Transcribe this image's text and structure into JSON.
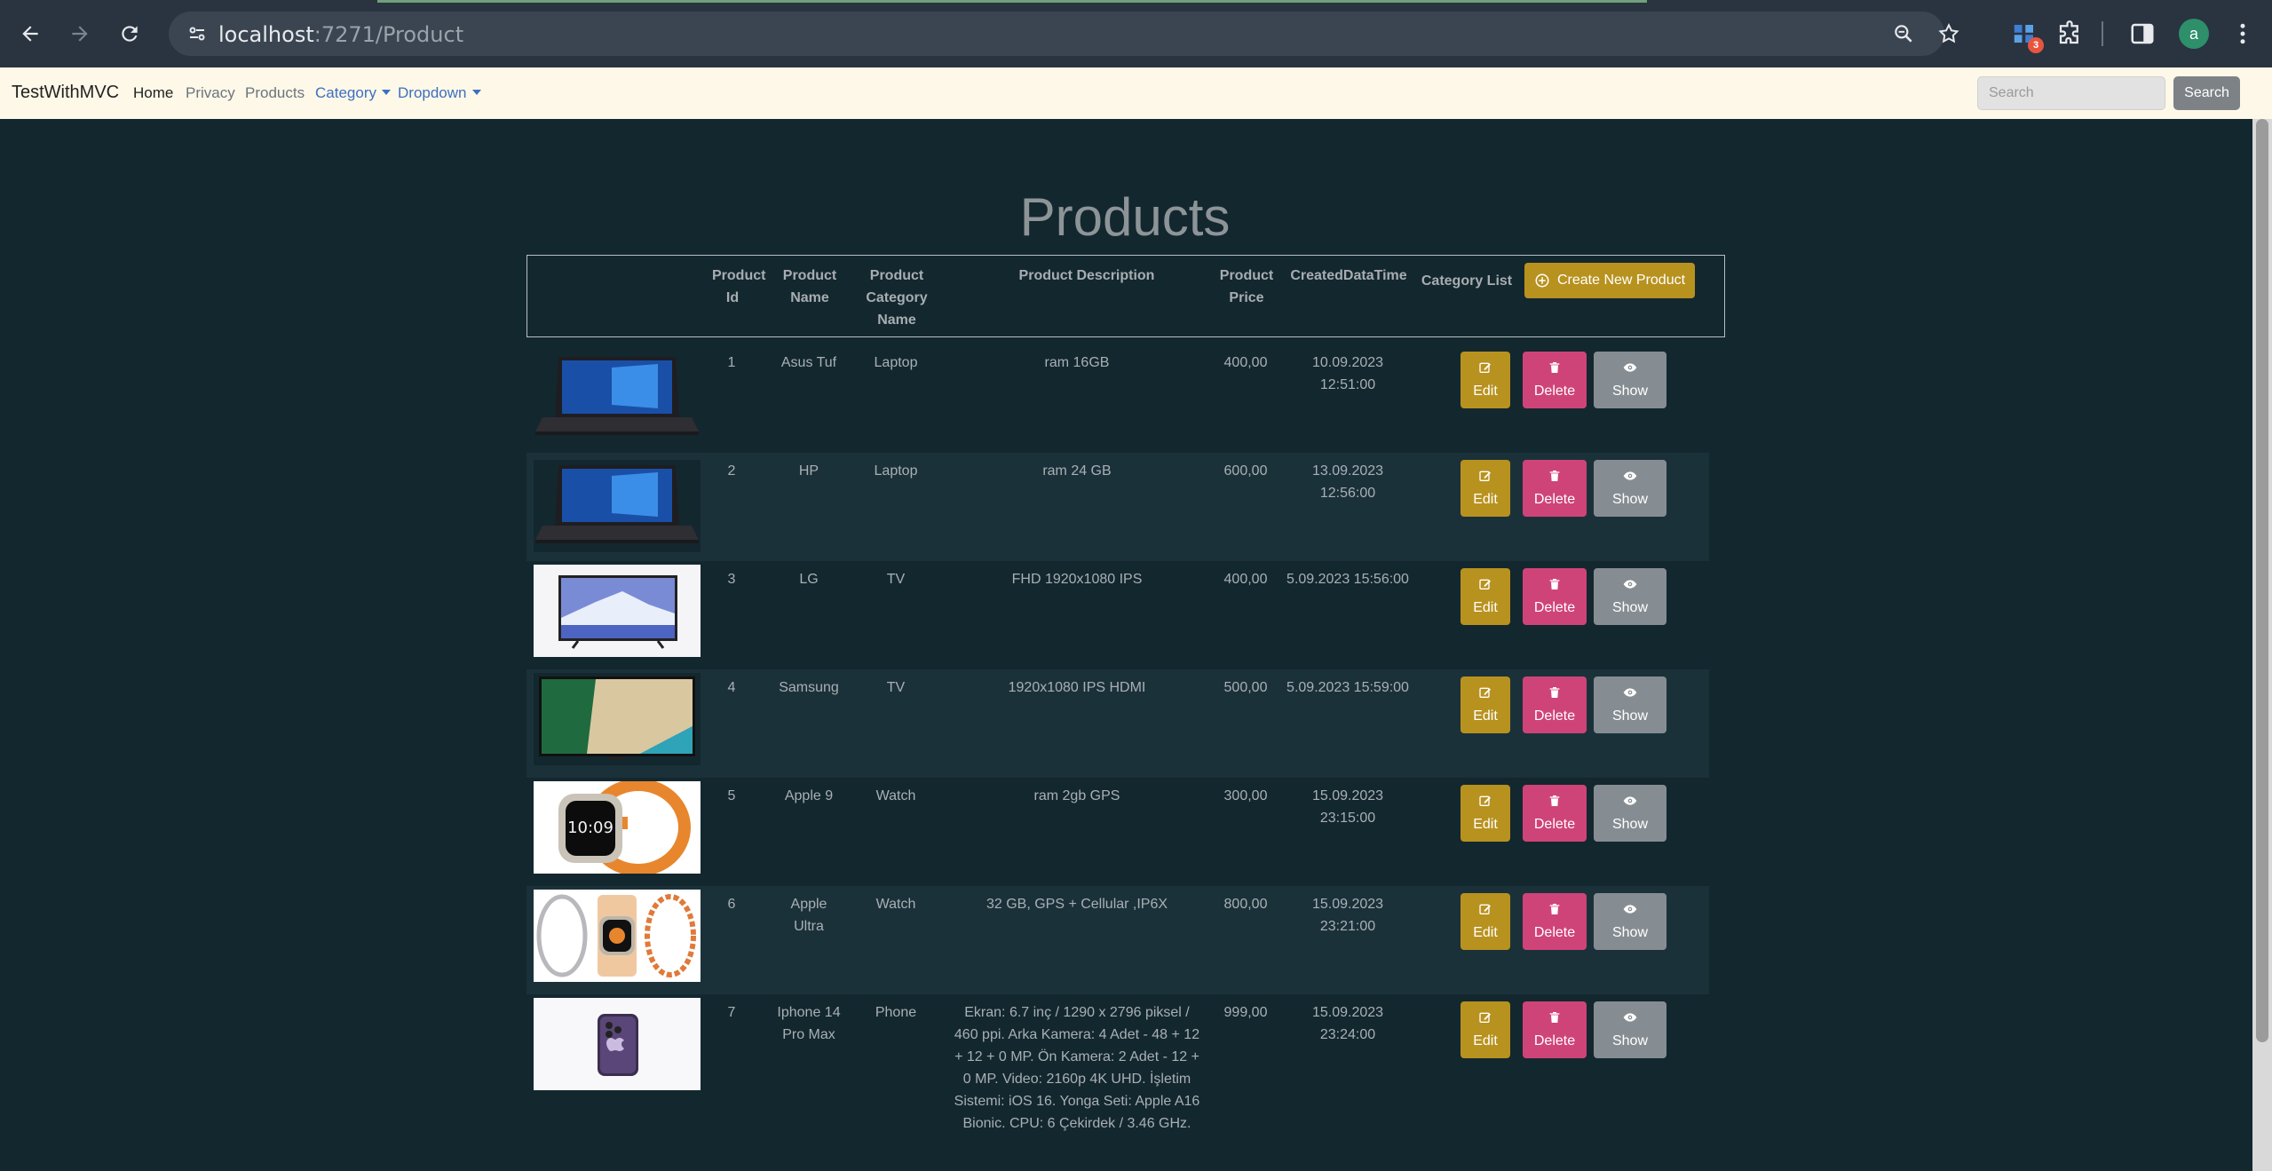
{
  "browser": {
    "url_host": "localhost",
    "url_path": ":7271/Product",
    "extension_badge": "3",
    "profile_initial": "a"
  },
  "navbar": {
    "brand": "TestWithMVC",
    "links": {
      "home": "Home",
      "privacy": "Privacy",
      "products": "Products",
      "category": "Category",
      "dropdown": "Dropdown"
    },
    "search_placeholder": "Search",
    "search_button": "Search"
  },
  "page": {
    "title": "Products",
    "headers": {
      "id": "Product Id",
      "name": "Product Name",
      "category": "Product Category Name",
      "description": "Product Description",
      "price": "Product Price",
      "created": "CreatedDataTime",
      "category_list": "Category List"
    },
    "create_button": "Create New Product",
    "action_labels": {
      "edit": "Edit",
      "delete": "Delete",
      "show": "Show"
    },
    "products": [
      {
        "id": "1",
        "name": "Asus Tuf",
        "category": "Laptop",
        "description": "ram 16GB",
        "price": "400,00",
        "created": "10.09.2023 12:51:00",
        "image": "laptop"
      },
      {
        "id": "2",
        "name": "HP",
        "category": "Laptop",
        "description": "ram 24 GB",
        "price": "600,00",
        "created": "13.09.2023 12:56:00",
        "image": "laptop"
      },
      {
        "id": "3",
        "name": "LG",
        "category": "TV",
        "description": "FHD 1920x1080 IPS",
        "price": "400,00",
        "created": "5.09.2023 15:56:00",
        "image": "tv-iceberg"
      },
      {
        "id": "4",
        "name": "Samsung",
        "category": "TV",
        "description": "1920x1080 IPS HDMI",
        "price": "500,00",
        "created": "5.09.2023 15:59:00",
        "image": "tv-beach"
      },
      {
        "id": "5",
        "name": "Apple 9",
        "category": "Watch",
        "description": "ram 2gb GPS",
        "price": "300,00",
        "created": "15.09.2023 23:15:00",
        "image": "watch"
      },
      {
        "id": "6",
        "name": "Apple Ultra",
        "category": "Watch",
        "description": "32 GB, GPS + Cellular ,IP6X",
        "price": "800,00",
        "created": "15.09.2023 23:21:00",
        "image": "watch-trio"
      },
      {
        "id": "7",
        "name": "Iphone 14 Pro Max",
        "category": "Phone",
        "description": "Ekran: 6.7 inç / 1290 x 2796 piksel / 460 ppi. Arka Kamera: 4 Adet - 48 + 12 + 12 + 0 MP. Ön Kamera: 2 Adet - 12 + 0 MP. Video: 2160p 4K UHD. İşletim Sistemi: iOS 16. Yonga Seti: Apple A16 Bionic. CPU: 6 Çekirdek / 3.46 GHz.",
        "price": "999,00",
        "created": "15.09.2023 23:24:00",
        "image": "phone"
      }
    ]
  },
  "colors": {
    "page_bg": "#13272f",
    "row_alt_bg": "#1b313a",
    "edit": "#b8921f",
    "delete": "#cf4478",
    "show": "#868d92",
    "navbar_bg": "#fdf8e8"
  }
}
